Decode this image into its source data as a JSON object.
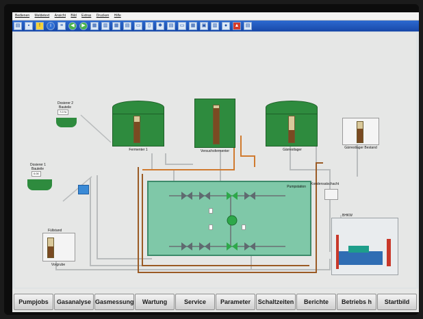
{
  "menu": [
    "Bedienen",
    "Meldetext",
    "Ansicht",
    "Bild",
    "Extras",
    "Drucken",
    "Hilfe"
  ],
  "tanks": {
    "fermenter": "Fermenter 1",
    "versuch": "Versuchsfermenter",
    "gaerrest": "Gärrestlager",
    "gaerrest_bestand": "Gärrestlager Bestand"
  },
  "dosierer2": {
    "title": "Dosierer 2",
    "sub": "Bauteile",
    "value": "7.0 %"
  },
  "dosierer1": {
    "title": "Dosierer 1",
    "sub": "Bauteile",
    "value": "0.00"
  },
  "pumpstation_label": "Pumpstation",
  "kondensatschacht": "Kondensatschacht",
  "bhkw": "BHKW",
  "vorgrube": "Vorgrube",
  "fuellstand": "Füllstand",
  "nav_buttons": [
    "Pumpjobs",
    "Gasanalyse",
    "Gasmessung",
    "Wartung",
    "Service",
    "Parameter",
    "Schaltzeiten",
    "Berichte",
    "Betriebs h",
    "Startbild"
  ],
  "colors": {
    "tank": "#2e8b3e",
    "pumpstation": "#7fc8a8",
    "pipe_brown": "#9a5a24",
    "pipe_orange": "#d07a2e",
    "pipe_grey": "#b9bcbd",
    "toolbar": "#1f55b8"
  }
}
